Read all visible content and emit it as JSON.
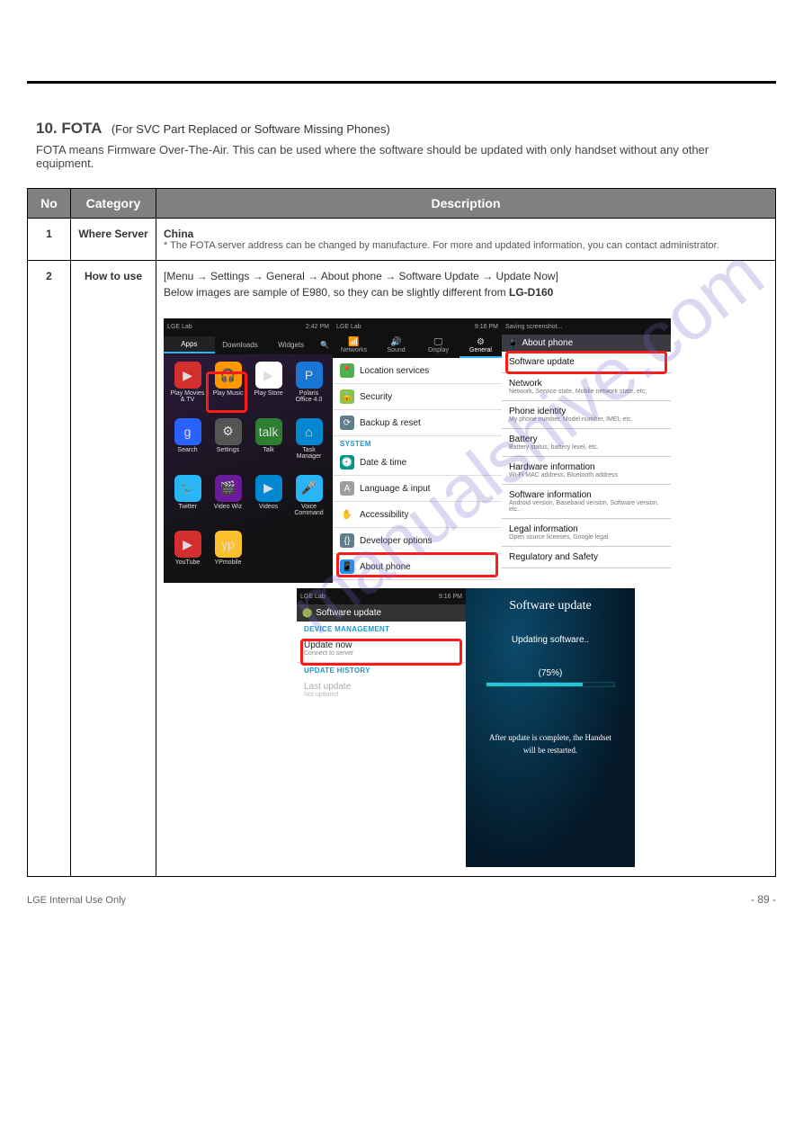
{
  "watermark": "manualshive.com",
  "title_line": "10. FOTA",
  "title_sub": "(For SVC Part Replaced or Software Missing Phones)",
  "subtext": "FOTA means Firmware Over-The-Air. This can be used where the software should be updated with only handset without any other equipment.",
  "table": {
    "headers": [
      "No",
      "Category",
      "Description"
    ],
    "row1": {
      "no": "1",
      "cat": "Where Server",
      "body_head": "China",
      "body_note": "* The FOTA server address can be changed by manufacture. For more and updated information, you can contact administrator."
    },
    "row2": {
      "no": "2",
      "cat": "How to use",
      "body_line1": "[Menu → Settings → General → About phone → Software Update → Update Now]",
      "body_line2_prefix": "Below images are sample of E980, so they can be slightly different from ",
      "body_line2_model": "LG-D160"
    }
  },
  "phone1": {
    "carrier": "LGE Lab",
    "time": "2:42 PM",
    "tabs": [
      "Apps",
      "Downloads",
      "Widgets"
    ],
    "apps": [
      {
        "label": "Play Movies & TV",
        "color": "#d32f2f",
        "glyph": "▶"
      },
      {
        "label": "Play Music",
        "color": "#ff9800",
        "glyph": "🎧"
      },
      {
        "label": "Play Store",
        "color": "#fff",
        "glyph": "▶"
      },
      {
        "label": "Polaris Office 4.0",
        "color": "#1976d2",
        "glyph": "P"
      },
      {
        "label": "Search",
        "color": "#2962ff",
        "glyph": "g"
      },
      {
        "label": "Settings",
        "color": "#555",
        "glyph": "⚙"
      },
      {
        "label": "Talk",
        "color": "#2e7d32",
        "glyph": "talk"
      },
      {
        "label": "Task Manager",
        "color": "#0288d1",
        "glyph": "⌂"
      },
      {
        "label": "Twitter",
        "color": "#29b6f6",
        "glyph": "🐦"
      },
      {
        "label": "Video Wiz",
        "color": "#6a1b9a",
        "glyph": "🎬"
      },
      {
        "label": "Videos",
        "color": "#0288d1",
        "glyph": "▶"
      },
      {
        "label": "Voice Command",
        "color": "#29b6f6",
        "glyph": "🎤"
      },
      {
        "label": "YouTube",
        "color": "#d32f2f",
        "glyph": "▶"
      },
      {
        "label": "YPmobile",
        "color": "#fbc02d",
        "glyph": "yp"
      }
    ]
  },
  "phone2": {
    "carrier": "LGE Lab",
    "time": "9:16 PM",
    "top_tabs": [
      {
        "icon": "📶",
        "label": "Networks"
      },
      {
        "icon": "🔊",
        "label": "Sound"
      },
      {
        "icon": "🖵",
        "label": "Display"
      },
      {
        "icon": "⚙",
        "label": "General"
      }
    ],
    "items": [
      {
        "icon_bg": "#4caf50",
        "glyph": "📍",
        "label": "Location services"
      },
      {
        "icon_bg": "#8bc34a",
        "glyph": "🔒",
        "label": "Security"
      },
      {
        "icon_bg": "#607d8b",
        "glyph": "⟳",
        "label": "Backup & reset"
      }
    ],
    "section": "SYSTEM",
    "items2": [
      {
        "icon_bg": "#009688",
        "glyph": "🕘",
        "label": "Date & time"
      },
      {
        "icon_bg": "#9e9e9e",
        "glyph": "A",
        "label": "Language & input"
      },
      {
        "icon_bg": "#fff",
        "glyph": "✋",
        "label": "Accessibility"
      },
      {
        "icon_bg": "#607d8b",
        "glyph": "{}",
        "label": "Developer options"
      },
      {
        "icon_bg": "#2196f3",
        "glyph": "📱",
        "label": "About phone"
      }
    ]
  },
  "phone3": {
    "saving": "Saving screenshot...",
    "header": "About phone",
    "items": [
      {
        "t": "Software update",
        "s": ""
      },
      {
        "t": "Network",
        "s": "Network, Service state, Mobile network state, etc."
      },
      {
        "t": "Phone identity",
        "s": "My phone number, Model number, IMEI, etc."
      },
      {
        "t": "Battery",
        "s": "Battery status, battery level, etc."
      },
      {
        "t": "Hardware information",
        "s": "Wi-Fi MAC address, Bluetooth address"
      },
      {
        "t": "Software information",
        "s": "Android version, Baseband version, Software version, etc."
      },
      {
        "t": "Legal information",
        "s": "Open source licenses, Google legal"
      },
      {
        "t": "Regulatory and Safety",
        "s": ""
      }
    ]
  },
  "phone4": {
    "carrier": "LGE Lab",
    "time": "9:16 PM",
    "header": "Software update",
    "sec1": "DEVICE MANAGEMENT",
    "item1_t": "Update now",
    "item1_s": "Connect to server",
    "sec2": "UPDATE HISTORY",
    "item2_t": "Last update",
    "item2_s": "Not updated"
  },
  "phone5": {
    "title": "Software update",
    "status": "Updating software..",
    "pct": "(75%)",
    "msg": "After update is complete, the Handset will be restarted."
  },
  "page_number": "- 89 -",
  "page_left": "LGE Internal Use Only"
}
